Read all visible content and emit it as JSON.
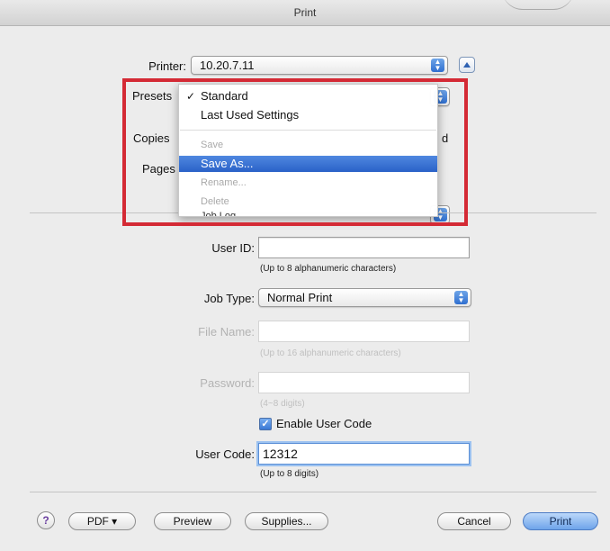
{
  "window": {
    "title": "Print"
  },
  "printer": {
    "label": "Printer:",
    "value": "10.20.7.11"
  },
  "presets": {
    "label": "Presets",
    "menu": {
      "items": [
        {
          "label": "Standard",
          "checked": true
        },
        {
          "label": "Last Used Settings"
        },
        {
          "label": "Save",
          "disabled": true
        },
        {
          "label": "Save As...",
          "highlighted": true
        },
        {
          "label": "Rename...",
          "disabled": true
        },
        {
          "label": "Delete",
          "disabled": true
        }
      ],
      "checkmark": "✓"
    }
  },
  "copies": {
    "label": "Copies",
    "suffix": "d"
  },
  "pages": {
    "label": "Pages"
  },
  "job_log_clip": {
    "text": "Job Log"
  },
  "user_id": {
    "label": "User ID:",
    "value": "",
    "hint": "(Up to 8 alphanumeric characters)"
  },
  "job_type": {
    "label": "Job Type:",
    "value": "Normal Print"
  },
  "file_name": {
    "label": "File Name:",
    "value": "",
    "hint": "(Up to 16 alphanumeric characters)"
  },
  "password": {
    "label": "Password:",
    "value": "",
    "hint": "(4~8 digits)"
  },
  "enable_user_code": {
    "label": "Enable User Code",
    "checked": true
  },
  "user_code": {
    "label": "User Code:",
    "value": "12312",
    "hint": "(Up to 8 digits)"
  },
  "buttons": {
    "help": "?",
    "pdf": "PDF ▾",
    "preview": "Preview",
    "supplies": "Supplies...",
    "cancel": "Cancel",
    "print": "Print"
  },
  "colors": {
    "highlight": "#2a62c8",
    "annotation_red": "#d42a35",
    "default_button": "#6ea4ea"
  },
  "icons": {
    "popup_arrows": "up-down-arrows-icon",
    "disclosure": "disclosure-triangle-icon",
    "checkmark": "checkmark-icon",
    "help": "question-mark-icon"
  }
}
